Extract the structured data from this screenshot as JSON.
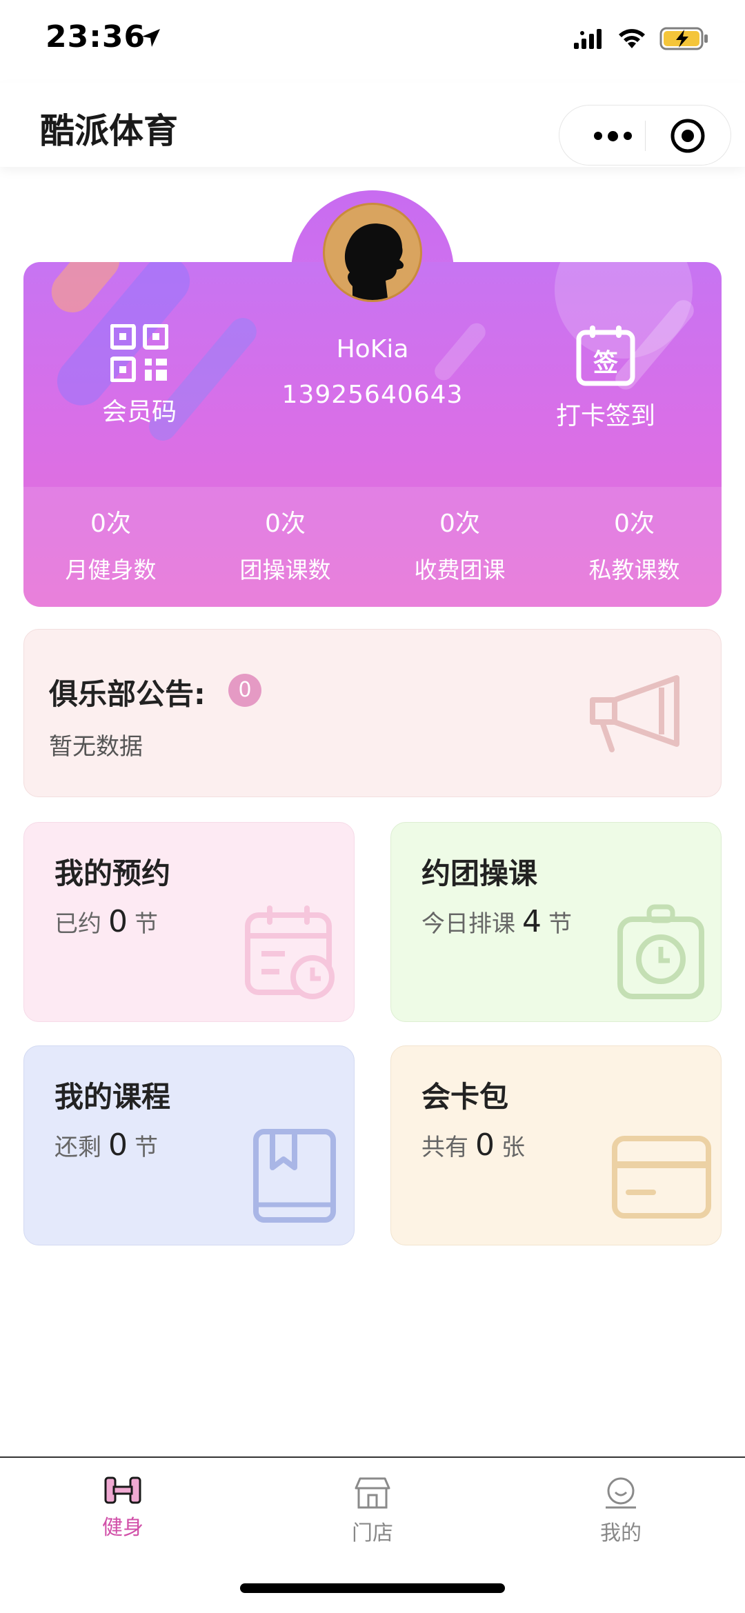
{
  "status_bar": {
    "time": "23:36"
  },
  "navbar": {
    "title": "酷派体育"
  },
  "profile": {
    "name": "HoKia",
    "phone": "13925640643",
    "member_code_label": "会员码",
    "checkin_label": "打卡签到",
    "checkin_icon_text": "签",
    "stats": [
      {
        "value": "0次",
        "label": "月健身数"
      },
      {
        "value": "0次",
        "label": "团操课数"
      },
      {
        "value": "0次",
        "label": "收费团课"
      },
      {
        "value": "0次",
        "label": "私教课数"
      }
    ]
  },
  "notice": {
    "title": "俱乐部公告:",
    "count": "0",
    "empty_text": "暂无数据"
  },
  "tiles": {
    "booking": {
      "title": "我的预约",
      "prefix": "已约",
      "value": "0",
      "unit": "节"
    },
    "group": {
      "title": "约团操课",
      "prefix": "今日排课",
      "value": "4",
      "unit": "节"
    },
    "course": {
      "title": "我的课程",
      "prefix": "还剩",
      "value": "0",
      "unit": "节"
    },
    "cards": {
      "title": "会卡包",
      "prefix": "共有",
      "value": "0",
      "unit": "张"
    }
  },
  "tabbar": {
    "tabs": [
      {
        "label": "健身",
        "active": true
      },
      {
        "label": "门店",
        "active": false
      },
      {
        "label": "我的",
        "active": false
      }
    ]
  },
  "colors": {
    "accent": "#d14fa8",
    "card_gradient_top": "#c774f2",
    "card_gradient_bottom": "#e66fd6",
    "notice_badge": "#e59ac4"
  }
}
